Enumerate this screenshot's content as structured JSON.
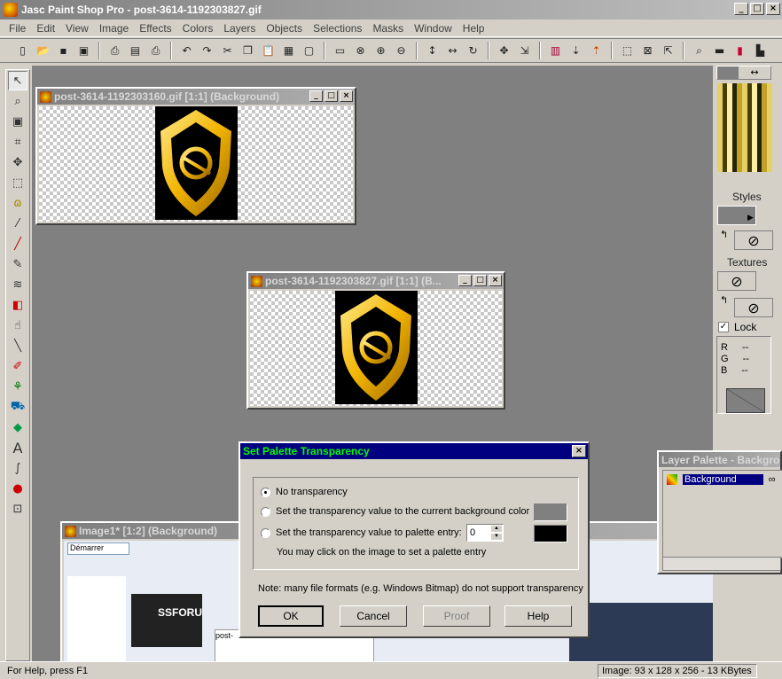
{
  "app": {
    "title": "Jasc Paint Shop Pro - post-3614-1192303827.gif"
  },
  "menu": [
    "File",
    "Edit",
    "View",
    "Image",
    "Effects",
    "Colors",
    "Layers",
    "Objects",
    "Selections",
    "Masks",
    "Window",
    "Help"
  ],
  "toolbar_icons": [
    "new-icon",
    "open-icon",
    "save-icon",
    "save-as-icon",
    "scan-icon",
    "browse-icon",
    "print-icon",
    "undo-icon",
    "redo-icon",
    "cut-icon",
    "copy-icon",
    "paste-icon",
    "paste-new-icon",
    "clear-icon",
    "full-screen-icon",
    "normal-view-icon",
    "zoom-in-icon",
    "zoom-out-icon",
    "flip-icon",
    "mirror-icon",
    "rotate-icon",
    "crop-icon",
    "resize-icon",
    "selection-icon",
    "count-colors-icon",
    "decrease-colors-icon",
    "increase-colors-icon",
    "grid-icon",
    "overview-icon",
    "tool-palette-icon",
    "tool-options-icon",
    "histogram-icon",
    "color-palette-icon"
  ],
  "tools": [
    "arrow",
    "zoom",
    "deform",
    "crop",
    "mover",
    "selection",
    "freehand",
    "dropper",
    "paintbrush",
    "clone",
    "color-replacer",
    "retouch",
    "scratch-remover",
    "eraser",
    "picture-tube",
    "airbrush",
    "flood-fill",
    "text",
    "draw",
    "preset-shapes",
    "object-selector"
  ],
  "windows": {
    "doc1": {
      "title": "post-3614-1192303160.gif [1:1] (Background)"
    },
    "doc2": {
      "title": "post-3614-1192303827.gif [1:1] (B..."
    },
    "doc3": {
      "title": "Image1* [1:2] (Background)",
      "sub1": "Démarrer",
      "sub2": "post-"
    }
  },
  "color_panel": {
    "styles": "Styles",
    "textures": "Textures",
    "lock": "Lock",
    "r": "R",
    "g": "G",
    "b": "B",
    "dash": "--"
  },
  "layer_palette": {
    "title": "Layer Palette - Backgrou",
    "layer": "Background"
  },
  "dialog": {
    "title": "Set Palette Transparency",
    "opt1": "No transparency",
    "opt2": "Set the transparency value to the current background color",
    "opt3": "Set the transparency value to palette entry:",
    "entry": "0",
    "hint": "You may click on the image to set a palette entry",
    "note": "Note:  many file formats (e.g. Windows Bitmap) do not support transparency",
    "ok": "OK",
    "cancel": "Cancel",
    "proof": "Proof",
    "help": "Help",
    "bg_swatch": "#808080",
    "entry_swatch": "#000000"
  },
  "status": {
    "help": "For Help, press F1",
    "image": "Image:  93 x 128 x 256 - 13 KBytes"
  }
}
